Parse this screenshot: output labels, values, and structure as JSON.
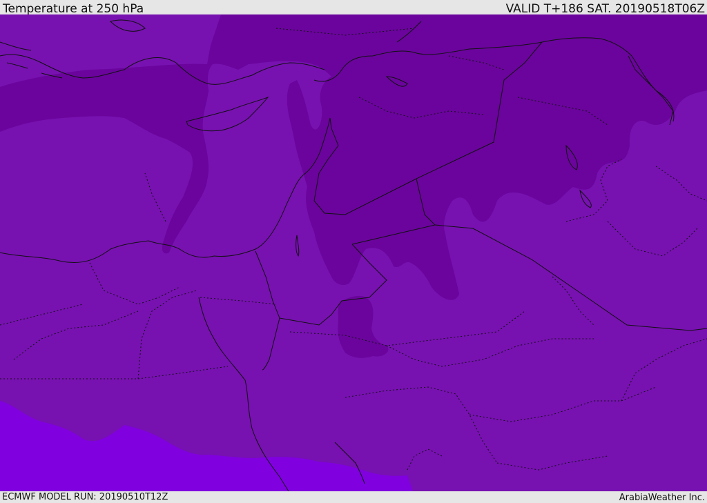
{
  "header": {
    "title": "Temperature at 250 hPa",
    "valid": "VALID T+186 SAT. 20190518T06Z"
  },
  "footer": {
    "model_run": "ECMWF MODEL RUN: 20190510T12Z",
    "credit": "ArabiaWeather Inc."
  },
  "colors": {
    "band_cold": "#6a049c",
    "band_mid": "#7711b0",
    "band_warm": "#8000e0",
    "bar_background": "#e6e6e6"
  }
}
